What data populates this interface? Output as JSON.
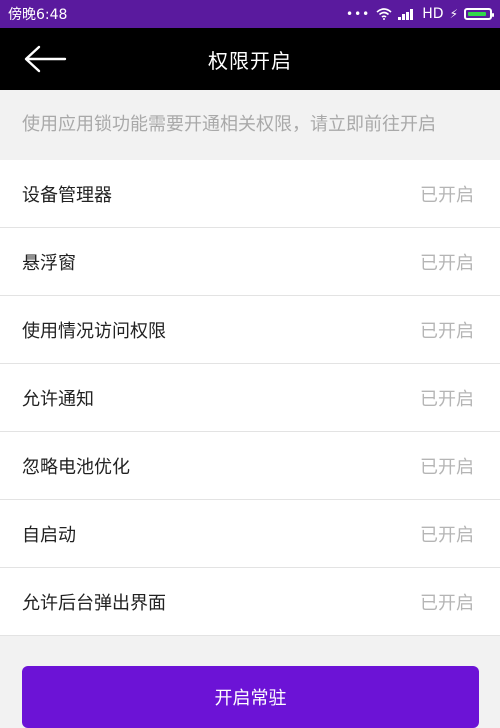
{
  "status_bar": {
    "time": "傍晚6:48",
    "more": "•••",
    "network": "HD",
    "charging": "⚡",
    "battery_level": 0.92,
    "colors": {
      "background": "#5a1a9e",
      "battery": "#32d74b"
    }
  },
  "header": {
    "title": "权限开启",
    "back_icon": "back-arrow-icon"
  },
  "hint": "使用应用锁功能需要开通相关权限，请立即前往开启",
  "permissions": [
    {
      "label": "设备管理器",
      "status": "已开启"
    },
    {
      "label": "悬浮窗",
      "status": "已开启"
    },
    {
      "label": "使用情况访问权限",
      "status": "已开启"
    },
    {
      "label": "允许通知",
      "status": "已开启"
    },
    {
      "label": "忽略电池优化",
      "status": "已开启"
    },
    {
      "label": "自启动",
      "status": "已开启"
    },
    {
      "label": "允许后台弹出界面",
      "status": "已开启"
    }
  ],
  "action_button": {
    "label": "开启常驻",
    "color": "#6c13d6"
  }
}
